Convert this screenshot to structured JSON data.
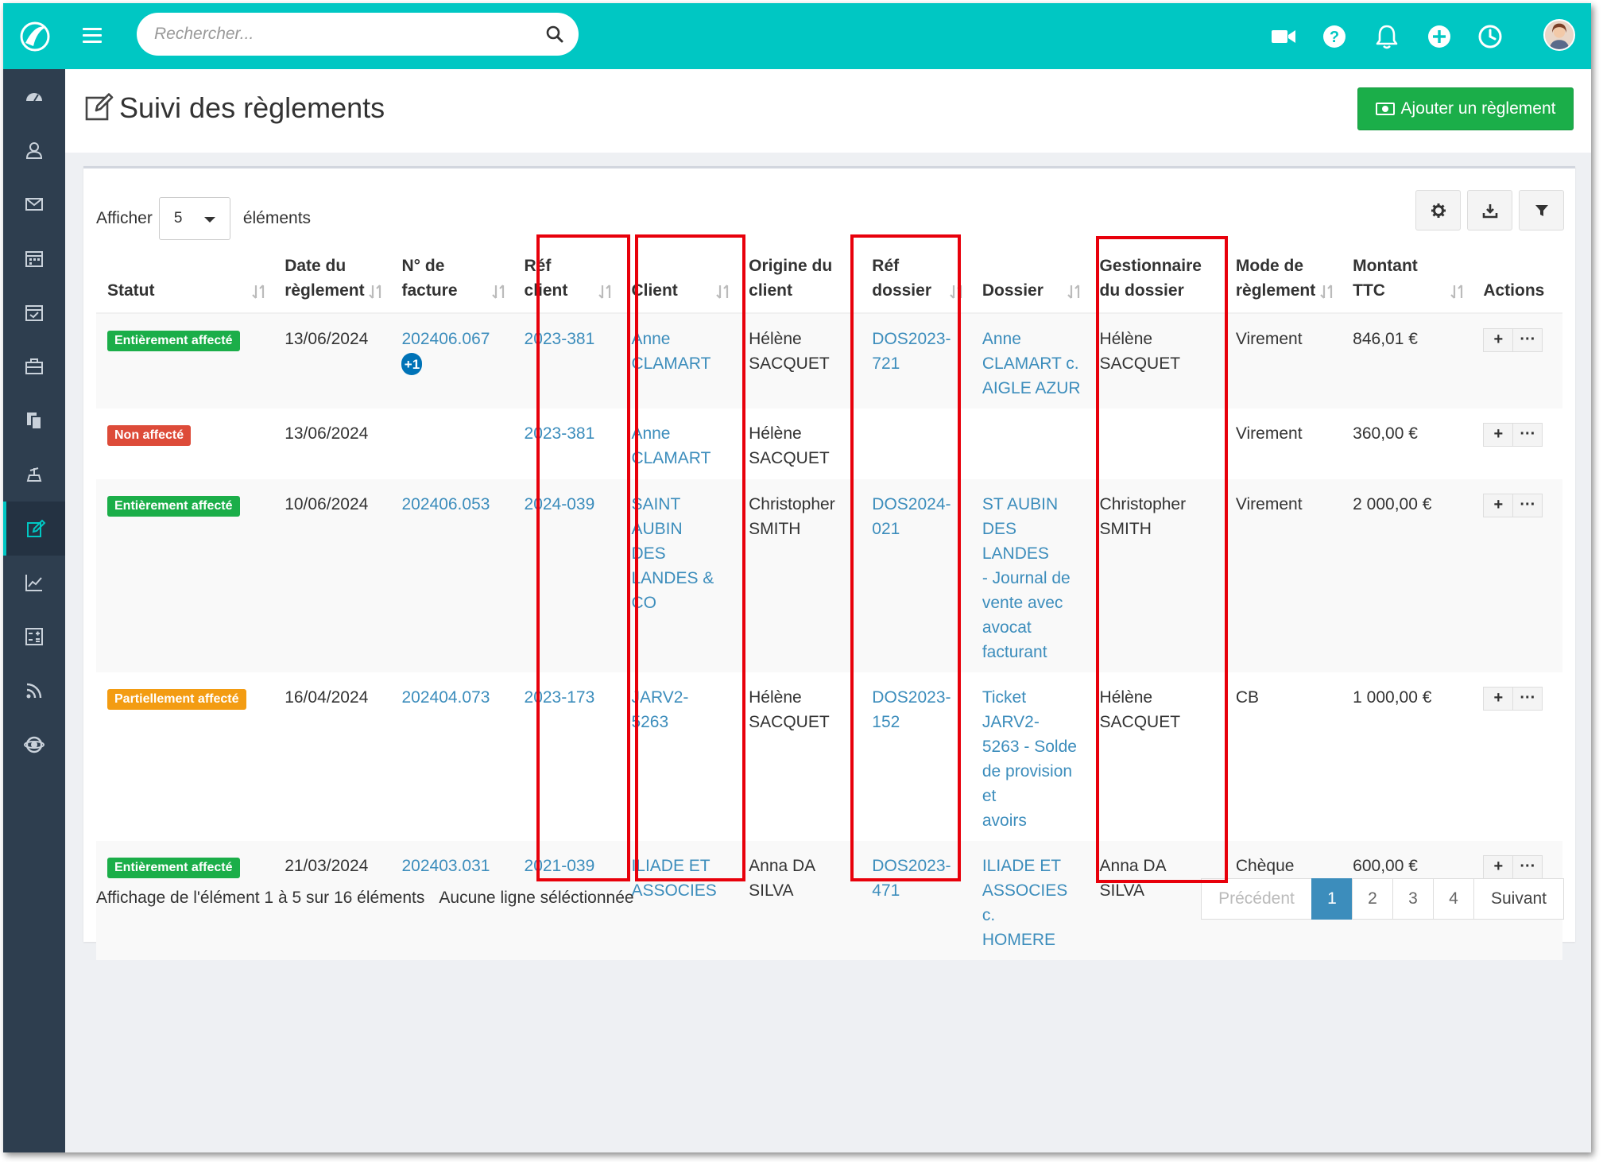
{
  "topbar": {
    "search_placeholder": "Rechercher...",
    "icons": [
      "video-icon",
      "help-icon",
      "bell-icon",
      "plus-circle-icon",
      "clock-icon",
      "user-avatar"
    ]
  },
  "sidebar": {
    "items": [
      "dashboard-icon",
      "contacts-icon",
      "mail-icon",
      "calendar-icon",
      "calendar-check-icon",
      "briefcase-icon",
      "documents-icon",
      "scale-icon",
      "payments-icon",
      "chart-icon",
      "calculator-icon",
      "rss-icon",
      "support-icon"
    ],
    "active": "payments-icon"
  },
  "page": {
    "title": "Suivi des règlements",
    "add_button": "Ajouter un règlement"
  },
  "length": {
    "prefix": "Afficher",
    "value": "5",
    "suffix": "éléments"
  },
  "toolbar": [
    "settings-icon",
    "download-icon",
    "filter-icon"
  ],
  "table": {
    "headers": {
      "statut": "Statut",
      "date_1": "Date du",
      "date_2": "règlement",
      "facture_1": "N° de",
      "facture_2": "facture",
      "refclient_1": "Réf",
      "refclient_2": "client",
      "client": "Client",
      "origine_1": "Origine du",
      "origine_2": "client",
      "refdossier_1": "Réf",
      "refdossier_2": "dossier",
      "dossier": "Dossier",
      "gest_1": "Gestionnaire",
      "gest_2": "du dossier",
      "mode_1": "Mode de",
      "mode_2": "règlement",
      "montant_1": "Montant",
      "montant_2": "TTC",
      "actions": "Actions"
    },
    "rows": [
      {
        "statut": "Entièrement affecté",
        "statut_color": "#1bae49",
        "date": "13/06/2024",
        "facture": "202406.067",
        "facture_more": "+1",
        "ref_client": "2023-381",
        "client_1": "Anne",
        "client_2": "CLAMART",
        "client_3": "",
        "client_4": "",
        "client_5": "",
        "origine_1": "Hélène",
        "origine_2": "SACQUET",
        "ref_dossier_1": "DOS2023-",
        "ref_dossier_2": "721",
        "dossier_1": "Anne",
        "dossier_2": "CLAMART c.",
        "dossier_3": "AIGLE AZUR",
        "dossier_4": "",
        "dossier_5": "",
        "dossier_6": "",
        "gest_1": "Hélène",
        "gest_2": "SACQUET",
        "mode": "Virement",
        "montant": "846,01 €"
      },
      {
        "statut": "Non affecté",
        "statut_color": "#dd4b39",
        "date": "13/06/2024",
        "facture": "",
        "facture_more": "",
        "ref_client": "2023-381",
        "client_1": "Anne",
        "client_2": "CLAMART",
        "client_3": "",
        "client_4": "",
        "client_5": "",
        "origine_1": "Hélène",
        "origine_2": "SACQUET",
        "ref_dossier_1": "",
        "ref_dossier_2": "",
        "dossier_1": "",
        "dossier_2": "",
        "dossier_3": "",
        "dossier_4": "",
        "dossier_5": "",
        "dossier_6": "",
        "gest_1": "",
        "gest_2": "",
        "mode": "Virement",
        "montant": "360,00 €"
      },
      {
        "statut": "Entièrement affecté",
        "statut_color": "#1bae49",
        "date": "10/06/2024",
        "facture": "202406.053",
        "facture_more": "",
        "ref_client": "2024-039",
        "client_1": "SAINT",
        "client_2": "AUBIN",
        "client_3": "DES",
        "client_4": "LANDES &",
        "client_5": "CO",
        "origine_1": "Christopher",
        "origine_2": "SMITH",
        "ref_dossier_1": "DOS2024-",
        "ref_dossier_2": "021",
        "dossier_1": "ST AUBIN",
        "dossier_2": "DES LANDES",
        "dossier_3": "- Journal de",
        "dossier_4": "vente avec",
        "dossier_5": "avocat",
        "dossier_6": "facturant",
        "gest_1": "Christopher",
        "gest_2": "SMITH",
        "mode": "Virement",
        "montant": "2 000,00 €"
      },
      {
        "statut": "Partiellement affecté",
        "statut_color": "#f39c12",
        "date": "16/04/2024",
        "facture": "202404.073",
        "facture_more": "",
        "ref_client": "2023-173",
        "client_1": "JARV2-",
        "client_2": "5263",
        "client_3": "",
        "client_4": "",
        "client_5": "",
        "origine_1": "Hélène",
        "origine_2": "SACQUET",
        "ref_dossier_1": "DOS2023-",
        "ref_dossier_2": "152",
        "dossier_1": "Ticket JARV2-",
        "dossier_2": "5263 - Solde",
        "dossier_3": "de provision et",
        "dossier_4": "avoirs",
        "dossier_5": "",
        "dossier_6": "",
        "gest_1": "Hélène",
        "gest_2": "SACQUET",
        "mode": "CB",
        "montant": "1 000,00 €"
      },
      {
        "statut": "Entièrement affecté",
        "statut_color": "#1bae49",
        "date": "21/03/2024",
        "facture": "202403.031",
        "facture_more": "",
        "ref_client": "2021-039",
        "client_1": "ILIADE ET",
        "client_2": "ASSOCIES",
        "client_3": "",
        "client_4": "",
        "client_5": "",
        "origine_1": "Anna DA",
        "origine_2": "SILVA",
        "ref_dossier_1": "DOS2023-",
        "ref_dossier_2": "471",
        "dossier_1": "ILIADE ET",
        "dossier_2": "ASSOCIES c.",
        "dossier_3": "HOMERE",
        "dossier_4": "",
        "dossier_5": "",
        "dossier_6": "",
        "gest_1": "Anna DA",
        "gest_2": "SILVA",
        "mode": "Chèque",
        "montant": "600,00 €"
      }
    ]
  },
  "footer": {
    "info": "Affichage de l'élément 1 à 5 sur 16 éléments",
    "selection": "Aucune ligne séléctionnée"
  },
  "pagination": {
    "prev": "Précédent",
    "pages": [
      "1",
      "2",
      "3",
      "4"
    ],
    "current": "1",
    "next": "Suivant"
  },
  "colors": {
    "topbar": "#00c7c3",
    "sidebar": "#2e3e4f",
    "link": "#3c8dbc",
    "highlight": "#e8000b",
    "add_button": "#1bae49"
  }
}
